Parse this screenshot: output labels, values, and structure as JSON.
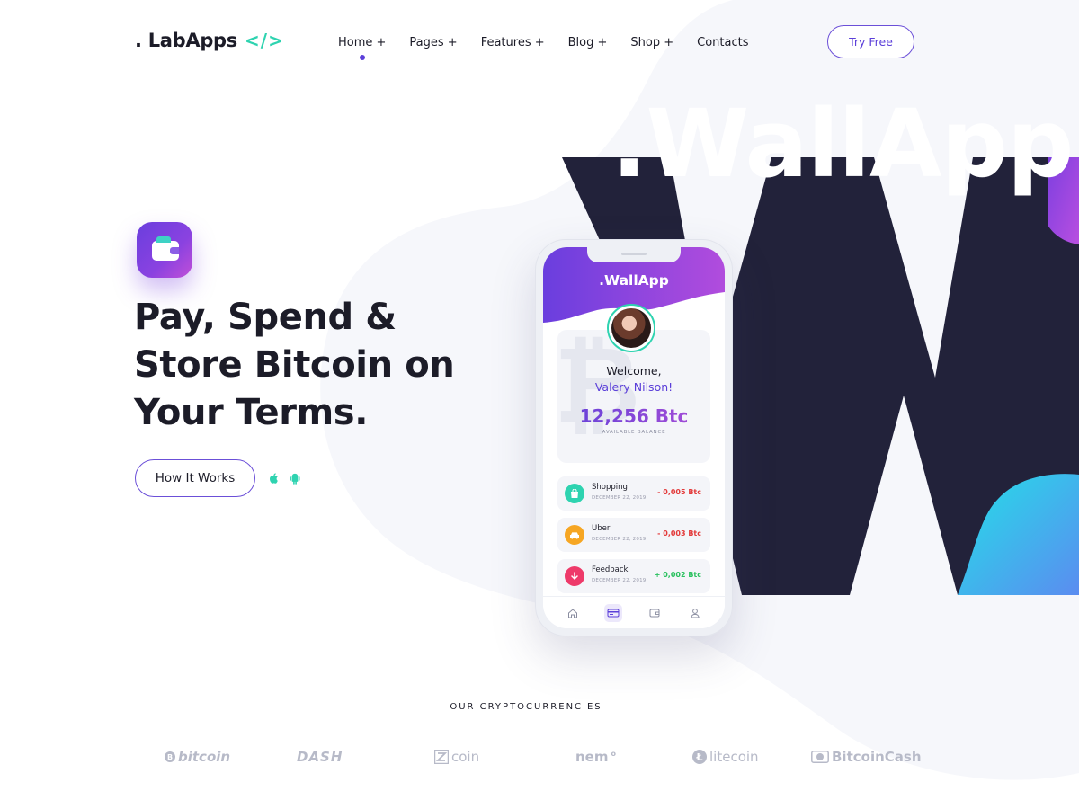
{
  "brand": {
    "name": ". LabApps",
    "code_glyph": "</>"
  },
  "nav": {
    "items": [
      {
        "label": "Home +",
        "active": true
      },
      {
        "label": "Pages +",
        "active": false
      },
      {
        "label": "Features +",
        "active": false
      },
      {
        "label": "Blog +",
        "active": false
      },
      {
        "label": "Shop +",
        "active": false
      },
      {
        "label": "Contacts",
        "active": false
      }
    ],
    "cta": "Try Free"
  },
  "hero": {
    "icon": "wallet-icon",
    "title_lines": [
      "Pay, Spend &",
      "Store Bitcoin on",
      "Your Terms."
    ],
    "button": "How It Works",
    "platforms": [
      "apple-icon",
      "android-icon"
    ]
  },
  "decor": {
    "big_text": ".WallApp",
    "big_letter": "W"
  },
  "phone": {
    "app_title": ".WallApp",
    "welcome": "Welcome,",
    "user_name": "Valery Nilson!",
    "balance": "12,256 Btc",
    "balance_label": "AVAILABLE BALANCE",
    "transactions": [
      {
        "name": "Shopping",
        "date": "DECEMBER 22, 2019",
        "amount": "- 0,005 Btc",
        "direction": "negative",
        "icon": "shopping-bag-icon",
        "color": "#2ed3b0"
      },
      {
        "name": "Uber",
        "date": "DECEMBER 22, 2019",
        "amount": "- 0,003 Btc",
        "direction": "negative",
        "icon": "car-icon",
        "color": "#f6a623"
      },
      {
        "name": "Feedback",
        "date": "DECEMBER 22, 2019",
        "amount": "+ 0,002 Btc",
        "direction": "positive",
        "icon": "arrow-down-icon",
        "color": "#ee3a6a"
      }
    ],
    "tabs": [
      "home-icon",
      "card-icon",
      "wallet-icon",
      "user-icon"
    ],
    "active_tab": "card-icon"
  },
  "cryptos": {
    "label": "OUR CRYPTOCURRENCIES",
    "coins": [
      "bitcoin",
      "DASH",
      "coin",
      "nem",
      "litecoin",
      "BitcoinCash"
    ]
  },
  "colors": {
    "accent": "#5b3fd9",
    "teal": "#2ed3b0",
    "dark": "#22223a",
    "text": "#1c1c28",
    "negative": "#e33a3a",
    "positive": "#29c05e"
  }
}
